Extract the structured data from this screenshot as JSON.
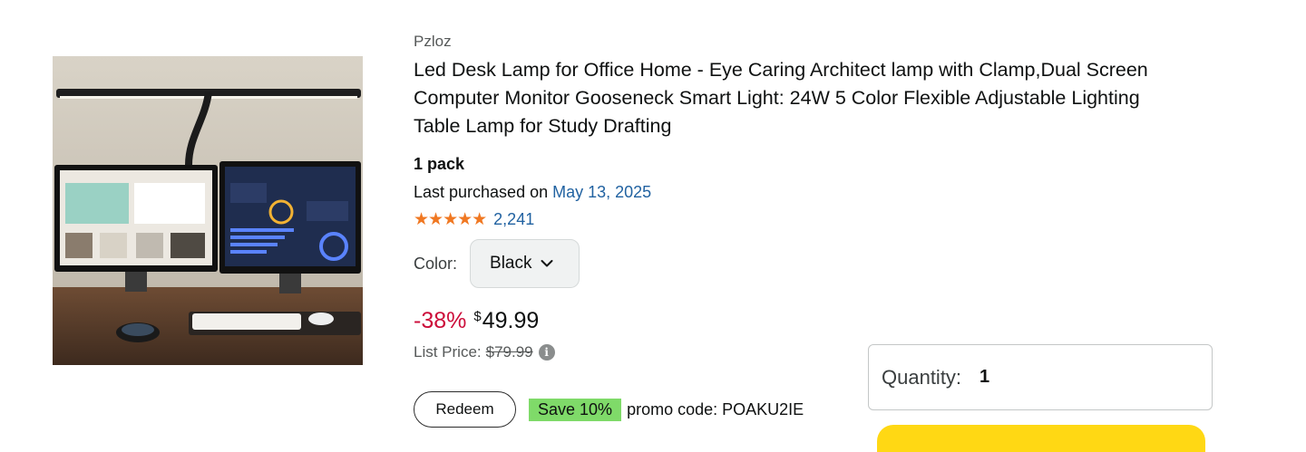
{
  "product": {
    "brand": "Pzloz",
    "title": "Led Desk Lamp for Office Home - Eye Caring Architect lamp with Clamp,Dual Screen Computer Monitor Gooseneck Smart Light: 24W 5 Color Flexible Adjustable Lighting Table Lamp for Study Drafting",
    "pack": "1 pack",
    "last_purchased_prefix": "Last purchased on",
    "last_purchased_date": "May 13, 2025",
    "rating_stars": "★★★★★",
    "rating_value_stars": 5,
    "rating_count": "2,241",
    "image_icon": "product-image"
  },
  "color": {
    "label": "Color:",
    "selected": "Black",
    "icon": "chevron-down-icon"
  },
  "price": {
    "discount": "-38%",
    "currency": "$",
    "amount": "49.99",
    "list_price_label": "List Price:",
    "list_price_value": "$79.99",
    "info_icon": "i"
  },
  "promo": {
    "redeem_label": "Redeem",
    "save_badge": "Save 10%",
    "code_text": "promo code: POAKU2IE"
  },
  "quantity": {
    "label": "Quantity:",
    "value": "1"
  },
  "colors": {
    "link": "#2162a1",
    "discount": "#cc0c39",
    "stars": "#f07822",
    "save_badge": "#7fda69",
    "add_button": "#ffd814"
  }
}
